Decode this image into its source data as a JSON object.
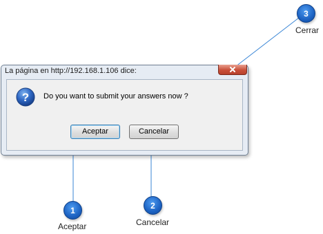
{
  "dialog": {
    "title": "La página en http://192.168.1.106 dice:",
    "message": "Do you want to submit your answers now ?",
    "icon": "question-icon",
    "buttons": {
      "accept": "Aceptar",
      "cancel": "Cancelar"
    },
    "close_icon": "close-icon"
  },
  "callouts": [
    {
      "number": "1",
      "label": "Aceptar"
    },
    {
      "number": "2",
      "label": "Cancelar"
    },
    {
      "number": "3",
      "label": "Cerrar"
    }
  ],
  "colors": {
    "callout_fill": "#1c62c2",
    "connector": "#3a86d6",
    "close_button": "#c9503a",
    "dialog_frame": "#e6ecf4"
  }
}
